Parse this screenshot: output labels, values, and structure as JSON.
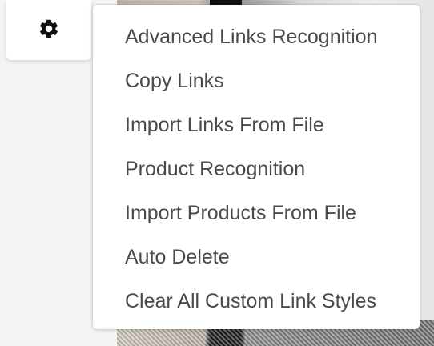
{
  "settings": {
    "icon": "gear-icon"
  },
  "menu": {
    "items": [
      {
        "label": "Advanced Links Recognition"
      },
      {
        "label": "Copy Links"
      },
      {
        "label": "Import Links From File"
      },
      {
        "label": "Product Recognition"
      },
      {
        "label": "Import Products From File"
      },
      {
        "label": "Auto Delete"
      },
      {
        "label": "Clear All Custom Link Styles"
      }
    ]
  },
  "colors": {
    "text": "#4a4a4a",
    "menu_bg": "#ffffff",
    "page_bg": "#f3f4f6"
  }
}
